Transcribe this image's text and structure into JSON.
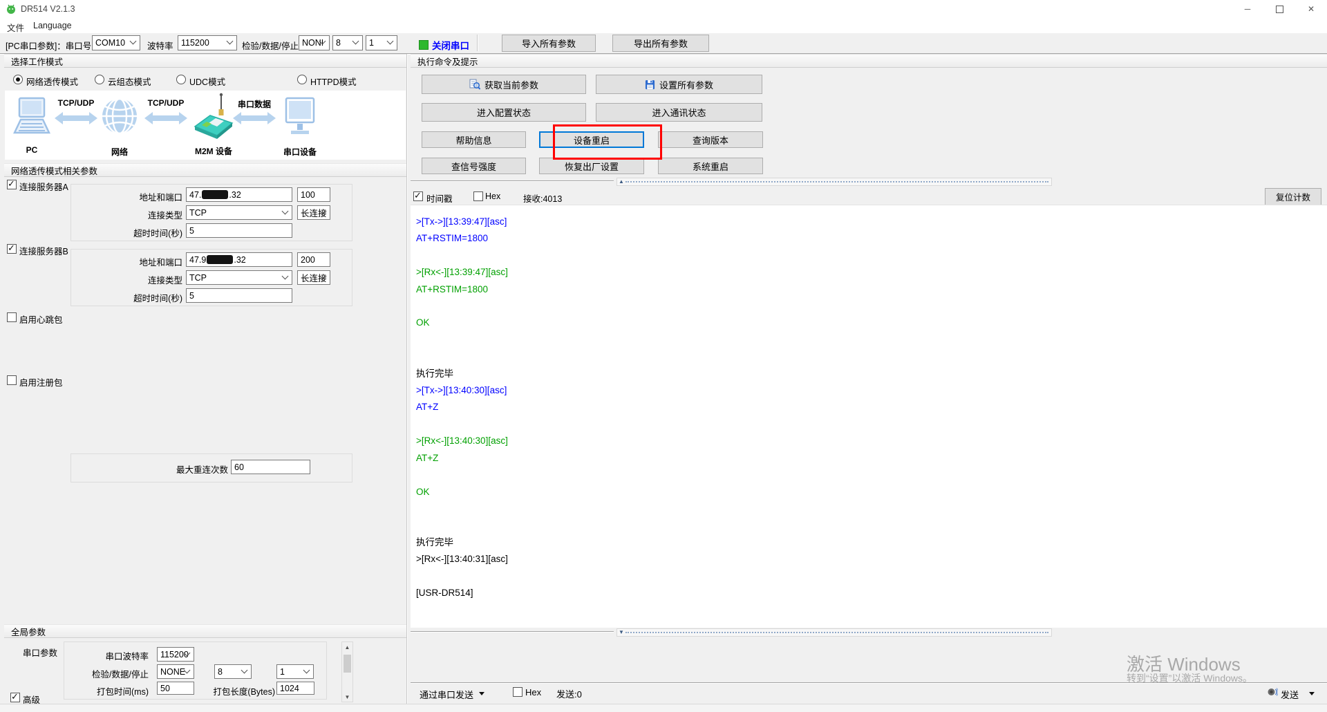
{
  "window": {
    "title": "DR514 V2.1.3"
  },
  "menu": {
    "file": "文件",
    "language": "Language"
  },
  "toolbar": {
    "port_label": "[PC串口参数]：串口号",
    "port": "COM10",
    "baud_label": "波特率",
    "baud": "115200",
    "parity_label": "检验/数据/停止",
    "parity": "NONI",
    "data_bits": "8",
    "stop_bits": "1",
    "close_port": "关闭串口",
    "import_all": "导入所有参数",
    "export_all": "导出所有参数"
  },
  "work_mode": {
    "header": "选择工作模式",
    "options": [
      {
        "label": "网络透传模式",
        "selected": true
      },
      {
        "label": "云组态模式",
        "selected": false
      },
      {
        "label": "UDC模式",
        "selected": false
      },
      {
        "label": "HTTPD模式",
        "selected": false
      }
    ]
  },
  "diagram": {
    "pc": "PC",
    "network": "网络",
    "m2m": "M2M 设备",
    "serial": "串口设备",
    "link1": "TCP/UDP",
    "link2": "TCP/UDP",
    "link3": "串口数据"
  },
  "net_params": {
    "header": "网络透传模式相关参数",
    "server_a": {
      "label": "连接服务器A",
      "checked": true,
      "addr_label": "地址和端口",
      "addr_prefix": "47.",
      "addr_suffix": ".32",
      "port": "100",
      "type_label": "连接类型",
      "type": "TCP",
      "keep": "长连接",
      "timeout_label": "超时时间(秒)",
      "timeout": "5"
    },
    "server_b": {
      "label": "连接服务器B",
      "checked": true,
      "addr_label": "地址和端口",
      "addr_prefix": "47.9",
      "addr_suffix": ".32",
      "port": "200",
      "type_label": "连接类型",
      "type": "TCP",
      "keep": "长连接",
      "timeout_label": "超时时间(秒)",
      "timeout": "5"
    },
    "heartbeat_label": "启用心跳包",
    "heartbeat_checked": false,
    "register_label": "启用注册包",
    "register_checked": false,
    "max_reconnect_label": "最大重连次数",
    "max_reconnect": "60"
  },
  "global_params": {
    "header": "全局参数",
    "serial_group_label": "串口参数",
    "baud_label": "串口波特率",
    "baud": "115200",
    "parity_label": "检验/数据/停止",
    "parity": "NONE",
    "data_bits": "8",
    "stop_bits": "1",
    "pack_time_label": "打包时间(ms)",
    "pack_time": "50",
    "pack_len_label": "打包长度(Bytes)",
    "pack_len": "1024",
    "advanced_label": "高级",
    "advanced_checked": true
  },
  "command_panel": {
    "header": "执行命令及提示",
    "buttons": [
      {
        "label": "获取当前参数"
      },
      {
        "label": "设置所有参数"
      },
      {
        "label": "进入配置状态"
      },
      {
        "label": "进入通讯状态"
      },
      {
        "label": "帮助信息"
      },
      {
        "label": "设备重启",
        "highlighted": true
      },
      {
        "label": "查询版本"
      },
      {
        "label": "查信号强度"
      },
      {
        "label": "恢复出厂设置"
      },
      {
        "label": "系统重启"
      }
    ]
  },
  "terminal": {
    "timestamp_label": "时间戳",
    "timestamp_checked": true,
    "hex_label": "Hex",
    "hex_checked": false,
    "recv_count": "接收:4013",
    "reset_count_label": "复位计数",
    "lines": [
      {
        "t": ">[Tx->][13:39:47][asc]",
        "c": "tx"
      },
      {
        "t": "AT+RSTIM=1800",
        "c": "tx"
      },
      {
        "t": "",
        "c": "sys"
      },
      {
        "t": ">[Rx<-][13:39:47][asc]",
        "c": "rx"
      },
      {
        "t": "AT+RSTIM=1800",
        "c": "rx"
      },
      {
        "t": "",
        "c": "sys"
      },
      {
        "t": "OK",
        "c": "rx"
      },
      {
        "t": "",
        "c": "sys"
      },
      {
        "t": "",
        "c": "sys"
      },
      {
        "t": "执行完毕",
        "c": "sys"
      },
      {
        "t": ">[Tx->][13:40:30][asc]",
        "c": "tx"
      },
      {
        "t": "AT+Z",
        "c": "tx"
      },
      {
        "t": "",
        "c": "sys"
      },
      {
        "t": ">[Rx<-][13:40:30][asc]",
        "c": "rx"
      },
      {
        "t": "AT+Z",
        "c": "rx"
      },
      {
        "t": "",
        "c": "sys"
      },
      {
        "t": "OK",
        "c": "rx"
      },
      {
        "t": "",
        "c": "sys"
      },
      {
        "t": "",
        "c": "sys"
      },
      {
        "t": "执行完毕",
        "c": "sys"
      },
      {
        "t": ">[Rx<-][13:40:31][asc]",
        "c": "sys"
      },
      {
        "t": "",
        "c": "sys"
      },
      {
        "t": "[USR-DR514]",
        "c": "sys"
      }
    ]
  },
  "send_bar": {
    "via_serial_label": "通过串口发送",
    "hex_label": "Hex",
    "hex_checked": false,
    "sent_count": "发送:0",
    "send_label": "发送"
  },
  "watermark": {
    "line1": "激活 Windows",
    "line2": "转到“设置”以激活 Windows。"
  },
  "colors": {
    "tx": "#0000ff",
    "rx": "#00a000",
    "close_port_text": "#0000ff",
    "port_open_indicator": "#2db82d",
    "annotation": "#ff0000",
    "focus_border": "#0078d7"
  }
}
